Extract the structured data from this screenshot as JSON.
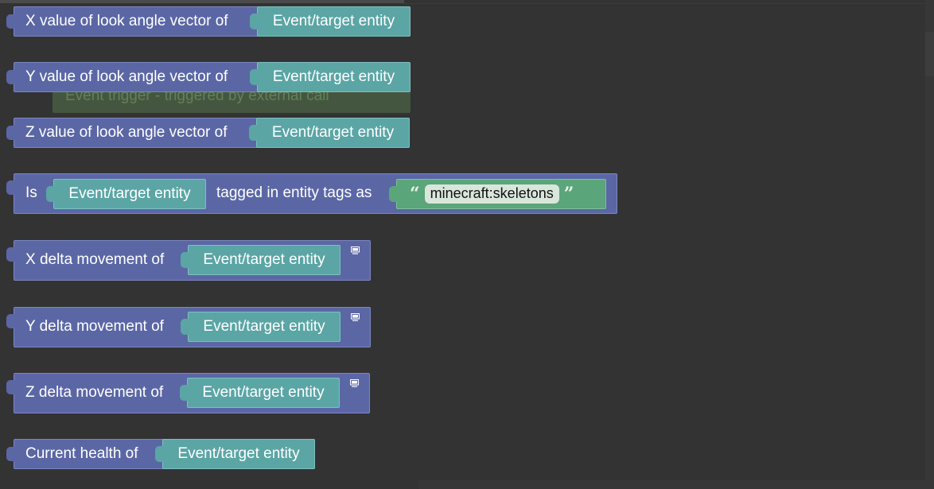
{
  "ghost": {
    "text": "Event trigger - triggered by external call"
  },
  "blocks": [
    {
      "label": "X value of look angle vector of",
      "input": "Event/target entity"
    },
    {
      "label": "Y value of look angle vector of",
      "input": "Event/target entity"
    },
    {
      "label": "Z value of look angle vector of",
      "input": "Event/target entity"
    },
    {
      "label": "Is",
      "input": "Event/target entity",
      "label2": "tagged in entity tags as",
      "string_value": "minecraft:skeletons",
      "open_quote": "“",
      "close_quote": "”"
    },
    {
      "label": "X delta movement of",
      "input": "Event/target entity",
      "icon": "computer-icon"
    },
    {
      "label": "Y delta movement of",
      "input": "Event/target entity",
      "icon": "computer-icon"
    },
    {
      "label": "Z delta movement of",
      "input": "Event/target entity",
      "icon": "computer-icon"
    },
    {
      "label": "Current health of",
      "input": "Event/target entity"
    }
  ],
  "colors": {
    "background": "#333333",
    "entity_block": "#5b67a5",
    "entity_input": "#5ba5a5",
    "string_block": "#5ba57a",
    "ghost_block": "#5b8050"
  }
}
